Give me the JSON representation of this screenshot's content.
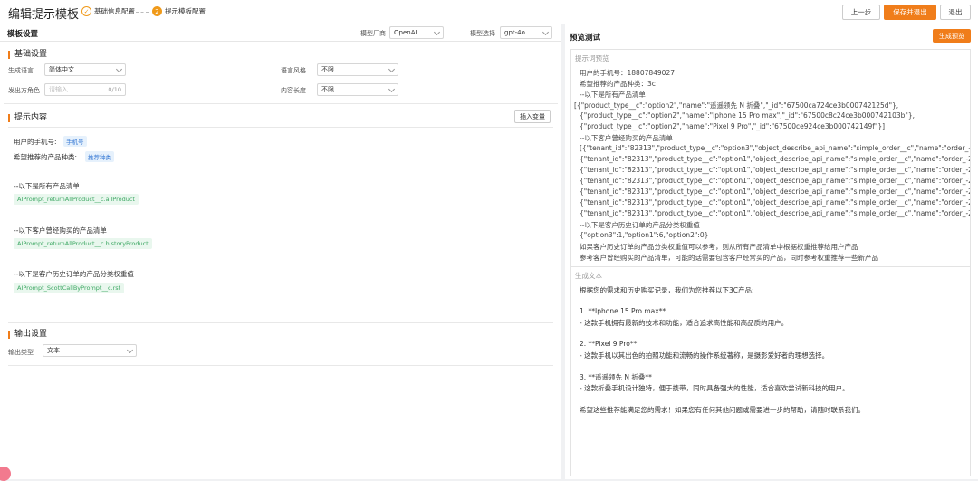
{
  "header": {
    "title": "编辑提示模板",
    "steps": [
      {
        "num": "✓",
        "label": "基础信息配置"
      },
      {
        "num": "2",
        "label": "提示模板配置"
      }
    ],
    "buttons": {
      "prev": "上一步",
      "save_exit": "保存并退出",
      "exit": "退出"
    }
  },
  "left_panel": {
    "title": "模板设置",
    "vendor_label": "模型厂商",
    "vendor_value": "OpenAI",
    "model_label": "模型选择",
    "model_value": "gpt-4o",
    "basic": {
      "title": "基础设置",
      "lang_label": "生成语言",
      "lang_value": "简体中文",
      "style_label": "语言风格",
      "style_value": "不限",
      "role_label": "发出方角色",
      "role_placeholder": "请输入",
      "role_counter": "0/10",
      "length_label": "内容长度",
      "length_value": "不限"
    },
    "prompt": {
      "title": "提示内容",
      "insert_var": "插入变量",
      "line_phone": "用户的手机号:",
      "tag_phone": "手机号",
      "line_product_type": "希望推荐的产品种类:",
      "tag_product_type": "推荐种类",
      "line_all_products": "--以下是所有产品清单",
      "tag_all_products": "AIPrompt_returnAllProduct__c.allProduct",
      "line_history": "--以下客户曾经购买的产品清单",
      "tag_history": "AIPrompt_returnAllProduct__c.historyProduct",
      "line_weights": "--以下是客户历史订单的产品分类权重值",
      "tag_weights": "AIPrompt_ScottCallByPrompt__c.rst"
    },
    "output": {
      "title": "输出设置",
      "type_label": "输出类型",
      "type_value": "文本"
    }
  },
  "right_panel": {
    "title": "预览测试",
    "generate_button": "生成预览",
    "preview_label": "提示词预览",
    "preview_lines": [
      "用户的手机号：18807849027",
      "希望推荐的产品种类：3c",
      "--以下是所有产品清单",
      "[{\"product_type__c\":\"option2\",\"name\":\"遥遥领先 N 折叠\",\"_id\":\"67500ca724ce3b000742125d\"},",
      "{\"product_type__c\":\"option2\",\"name\":\"Iphone 15 Pro max\",\"_id\":\"67500c8c24ce3b000742103b\"},",
      "{\"product_type__c\":\"option2\",\"name\":\"Pixel 9 Pro\",\"_id\":\"67500ce924ce3b000742149f\"}]",
      "--以下客户曾经购买的产品清单",
      "[{\"tenant_id\":\"82313\",\"product_type__c\":\"option3\",\"object_describe_api_name\":\"simple_order__c\",\"name\":\"order_-20241205",
      "{\"tenant_id\":\"82313\",\"product_type__c\":\"option1\",\"object_describe_api_name\":\"simple_order__c\",\"name\":\"order_-20241204",
      "{\"tenant_id\":\"82313\",\"product_type__c\":\"option1\",\"object_describe_api_name\":\"simple_order__c\",\"name\":\"order_-20241128",
      "{\"tenant_id\":\"82313\",\"product_type__c\":\"option1\",\"object_describe_api_name\":\"simple_order__c\",\"name\":\"order_-20241128",
      "{\"tenant_id\":\"82313\",\"product_type__c\":\"option1\",\"object_describe_api_name\":\"simple_order__c\",\"name\":\"order_-20241128",
      "{\"tenant_id\":\"82313\",\"product_type__c\":\"option1\",\"object_describe_api_name\":\"simple_order__c\",\"name\":\"order_-20241120",
      "{\"tenant_id\":\"82313\",\"product_type__c\":\"option1\",\"object_describe_api_name\":\"simple_order__c\",\"name\":\"order_-20241106",
      "--以下是客户历史订单的产品分类权重值",
      "{\"option3\":1,\"option1\":6,\"option2\":0}",
      "如果客户历史订单的产品分类权重值可以参考，则从所有产品清单中根据权重推荐给用户产品",
      "参考客户曾经购买的产品清单，可能的话需要包含客户经常买的产品，同时参考权重推荐一些新产品"
    ],
    "gen_label": "生成文本",
    "gen_lines": [
      "根据您的需求和历史购买记录，我们为您推荐以下3C产品:",
      "",
      "1. **Iphone 15 Pro max**",
      "   - 这款手机拥有最新的技术和功能，适合追求高性能和高品质的用户。",
      "",
      "2. **Pixel 9 Pro**",
      "   - 这款手机以其出色的拍照功能和流畅的操作系统著称，是摄影爱好者的理想选择。",
      "",
      "3. **遥遥领先 N 折叠**",
      "   - 这款折叠手机设计独特，便于携带，同时具备强大的性能，适合喜欢尝试新科技的用户。",
      "",
      "希望这些推荐能满足您的需求！如果您有任何其他问题或需要进一步的帮助，请随时联系我们。"
    ]
  }
}
